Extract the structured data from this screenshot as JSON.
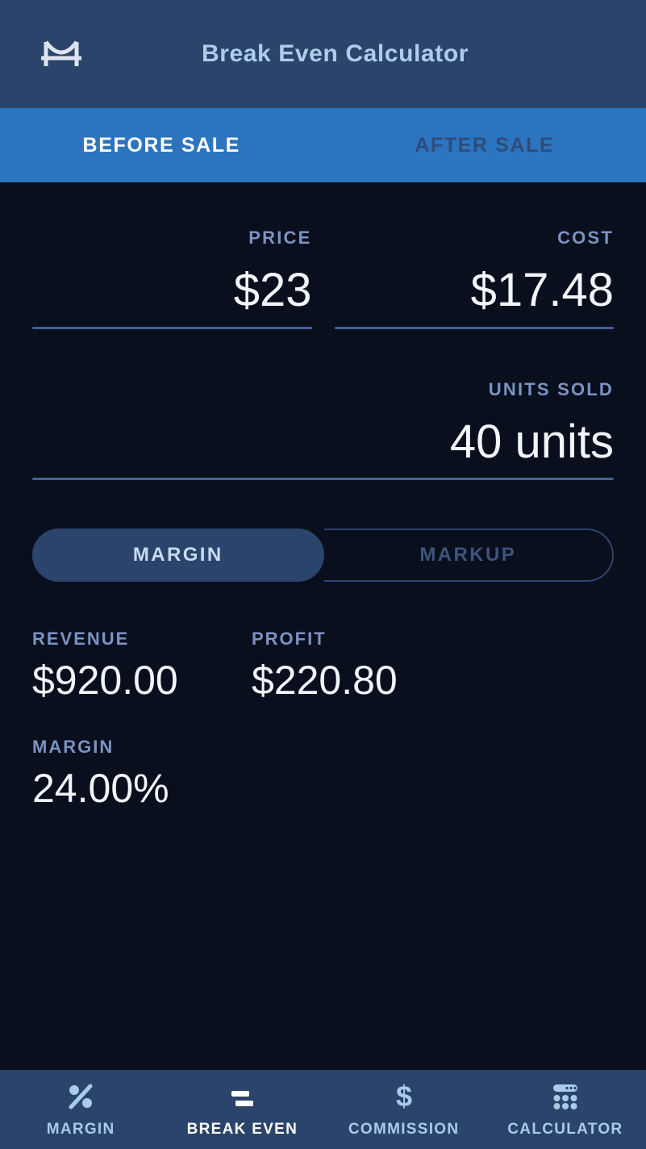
{
  "header": {
    "title": "Break Even Calculator",
    "logo_icon": "bridge-logo-icon"
  },
  "tabs": [
    {
      "label": "BEFORE SALE",
      "active": true
    },
    {
      "label": "AFTER SALE",
      "active": false
    }
  ],
  "inputs": {
    "price": {
      "label": "PRICE",
      "value": "$23"
    },
    "cost": {
      "label": "COST",
      "value": "$17.48"
    },
    "units": {
      "label": "UNITS SOLD",
      "value": "40 units"
    }
  },
  "mode_toggle": {
    "margin": {
      "label": "MARGIN",
      "selected": true
    },
    "markup": {
      "label": "MARKUP",
      "selected": false
    }
  },
  "results": {
    "revenue": {
      "label": "REVENUE",
      "value": "$920.00"
    },
    "profit": {
      "label": "PROFIT",
      "value": "$220.80"
    },
    "margin": {
      "label": "MARGIN",
      "value": "24.00%"
    }
  },
  "bottom_nav": [
    {
      "label": "MARGIN",
      "icon": "percent-icon",
      "active": false
    },
    {
      "label": "BREAK EVEN",
      "icon": "equals-icon",
      "active": true
    },
    {
      "label": "COMMISSION",
      "icon": "dollar-icon",
      "active": false
    },
    {
      "label": "CALCULATOR",
      "icon": "calculator-icon",
      "active": false
    }
  ],
  "colors": {
    "background": "#0a0f1d",
    "header": "#2b446b",
    "tabbar": "#2d74bf",
    "label": "#7b93c4",
    "value": "#f2f5fa",
    "underline": "#44608f",
    "nav_inactive": "#a8cbe8"
  }
}
